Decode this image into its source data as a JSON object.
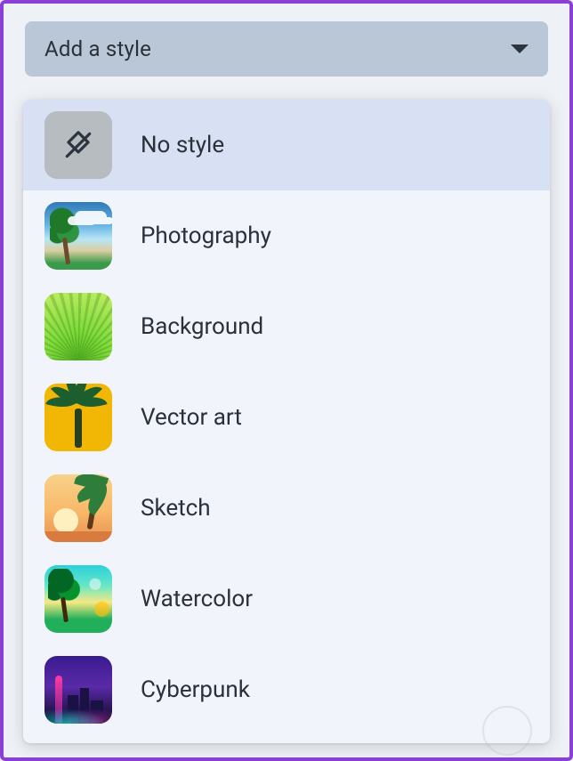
{
  "dropdown": {
    "label": "Add a style",
    "options": [
      {
        "id": "none",
        "label": "No style",
        "selected": true
      },
      {
        "id": "photography",
        "label": "Photography",
        "selected": false
      },
      {
        "id": "background",
        "label": "Background",
        "selected": false
      },
      {
        "id": "vector",
        "label": "Vector art",
        "selected": false
      },
      {
        "id": "sketch",
        "label": "Sketch",
        "selected": false
      },
      {
        "id": "watercolor",
        "label": "Watercolor",
        "selected": false
      },
      {
        "id": "cyberpunk",
        "label": "Cyberpunk",
        "selected": false
      }
    ]
  },
  "colors": {
    "accent_border": "#8b3fd9",
    "trigger_bg": "#b9c7d6",
    "panel_bg": "#f1f4fb",
    "selected_bg": "#d8e1f3"
  }
}
